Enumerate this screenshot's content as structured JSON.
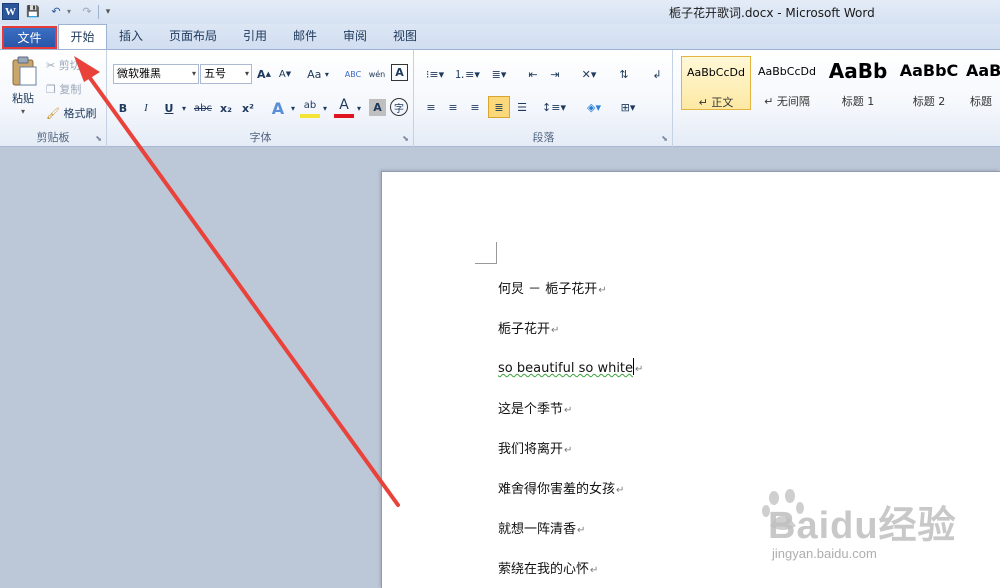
{
  "window": {
    "title": "栀子花开歌词.docx - Microsoft Word"
  },
  "quick_access": {
    "logo": "W",
    "save": "💾",
    "undo": "↶",
    "undo_drop": "▾",
    "redo": "↷",
    "customize": "▾"
  },
  "tabs": [
    "文件",
    "开始",
    "插入",
    "页面布局",
    "引用",
    "邮件",
    "审阅",
    "视图"
  ],
  "clipboard": {
    "paste": "粘贴",
    "cut": "剪切",
    "copy": "复制",
    "format_painter": "格式刷",
    "group": "剪贴板"
  },
  "font": {
    "name": "微软雅黑",
    "size": "五号",
    "group": "字体",
    "grow": "A",
    "shrink": "A",
    "case": "Aa",
    "clear": "ABC",
    "phonetic": "wén",
    "border": "A",
    "bold": "B",
    "italic": "I",
    "underline": "U",
    "strike": "abc",
    "sub": "x₂",
    "sup": "x²",
    "effects": "A",
    "highlight": "ab",
    "color": "A",
    "shading": "A",
    "enclose": "字"
  },
  "paragraph": {
    "group": "段落"
  },
  "styles": {
    "items": [
      {
        "sample": "AaBbCcDd",
        "name": "↵ 正文"
      },
      {
        "sample": "AaBbCcDd",
        "name": "↵ 无间隔"
      },
      {
        "sample": "AaBb",
        "name": "标题 1"
      },
      {
        "sample": "AaBbC",
        "name": "标题 2"
      },
      {
        "sample": "AaB",
        "name": "标题"
      }
    ]
  },
  "document": {
    "lines": [
      "何炅 － 栀子花开",
      "栀子花开",
      "so beautiful so white",
      "这是个季节",
      "我们将离开",
      "难舍得你害羞的女孩",
      "就想一阵清香",
      "萦绕在我的心怀"
    ],
    "para_mark": "↵"
  },
  "watermark": {
    "text": "Baidu经验",
    "url": "jingyan.baidu.com"
  },
  "colors": {
    "file_tab": "#2a56a8",
    "highlight_box": "#e63a3a",
    "arrow": "#e8423a",
    "page_bg": "#bcc7d8"
  }
}
